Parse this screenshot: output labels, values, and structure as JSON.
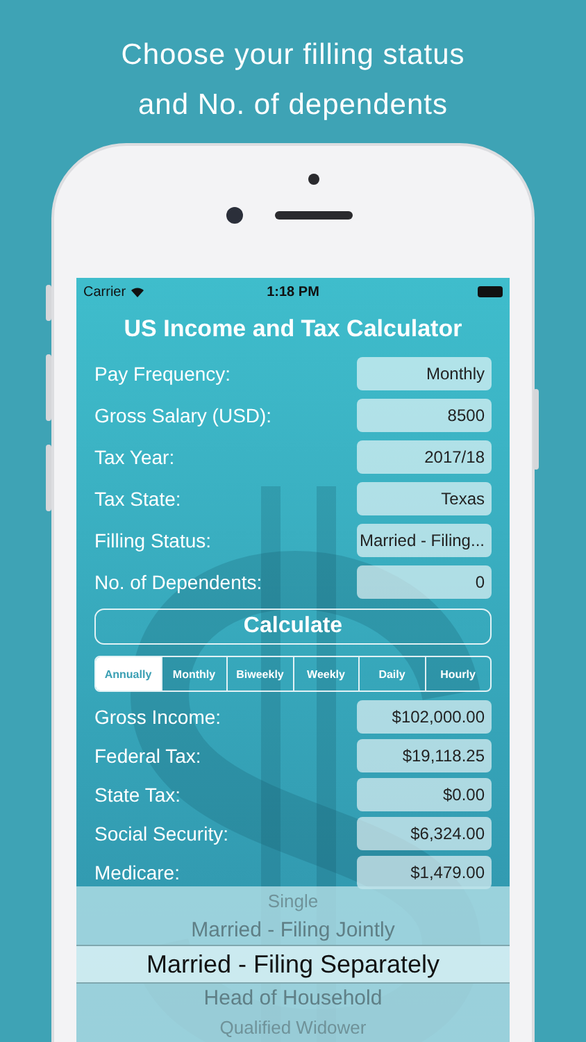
{
  "headline": [
    "Choose your filling status",
    "and No. of dependents"
  ],
  "status_bar": {
    "carrier": "Carrier",
    "time": "1:18 PM"
  },
  "title": "US Income and Tax Calculator",
  "inputs": [
    {
      "label": "Pay Frequency:",
      "value": "Monthly"
    },
    {
      "label": "Gross Salary (USD):",
      "value": "8500"
    },
    {
      "label": "Tax Year:",
      "value": "2017/18"
    },
    {
      "label": "Tax State:",
      "value": "Texas"
    },
    {
      "label": "Filling Status:",
      "value": "Married - Filing..."
    },
    {
      "label": "No. of Dependents:",
      "value": "0"
    }
  ],
  "calculate_button": "Calculate",
  "period_tabs": [
    {
      "label": "Annually",
      "selected": true
    },
    {
      "label": "Monthly",
      "selected": false
    },
    {
      "label": "Biweekly",
      "selected": false
    },
    {
      "label": "Weekly",
      "selected": false
    },
    {
      "label": "Daily",
      "selected": false
    },
    {
      "label": "Hourly",
      "selected": false
    }
  ],
  "results": [
    {
      "label": "Gross Income:",
      "value": "$102,000.00"
    },
    {
      "label": "Federal Tax:",
      "value": "$19,118.25"
    },
    {
      "label": "State Tax:",
      "value": "$0.00"
    },
    {
      "label": "Social Security:",
      "value": "$6,324.00"
    },
    {
      "label": "Medicare:",
      "value": "$1,479.00"
    }
  ],
  "picker": {
    "items": [
      {
        "label": "Single",
        "selected": false
      },
      {
        "label": "Married - Filing Jointly",
        "selected": false
      },
      {
        "label": "Married - Filing Separately",
        "selected": true
      },
      {
        "label": "Head of Household",
        "selected": false
      },
      {
        "label": "Qualified Widower",
        "selected": false
      }
    ]
  }
}
